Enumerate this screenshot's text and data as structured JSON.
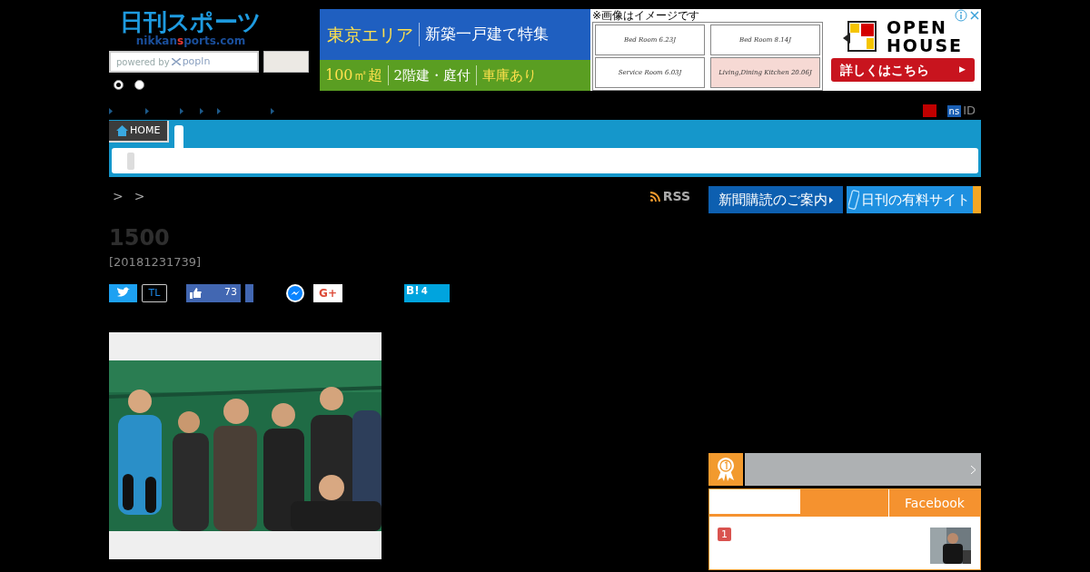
{
  "logo": {
    "title": "日刊スポーツ",
    "domain_prefix": "nikkan",
    "domain_mark": "s",
    "domain_suffix": "ports.com"
  },
  "search": {
    "placeholder_lead": "powered by",
    "placeholder_brand": "popln"
  },
  "search_scope": [
    {
      "selected": true
    },
    {
      "selected": false
    }
  ],
  "ad": {
    "headline_1": "東京エリア",
    "headline_2": "新築一戸建て特集",
    "feature_1": "100㎡超",
    "feature_2": "2階建・庭付",
    "feature_3": "車庫あり",
    "notice": "※画像はイメージです",
    "rooms": [
      "Bed Room 6.23J",
      "Bed Room 8.14J",
      "Service Room 6.03J",
      "Living,Dining Kitchen 20.06J"
    ],
    "brand_1": "OPEN",
    "brand_2": "HOUSE",
    "cta": "詳しくはこちら",
    "cta_arrow": "▶"
  },
  "account": {
    "badge": "ns",
    "label": "ID"
  },
  "nav_tabs": [
    {
      "label": "HOME",
      "selected": true
    },
    {
      "selected": false
    }
  ],
  "breadcrumb": [
    ">",
    ">"
  ],
  "rss": "RSS",
  "promo_buttons": [
    {
      "label": "新聞購読のご案内",
      "kind": "plain"
    },
    {
      "label": "日刊の有料サイト",
      "kind": "phone"
    }
  ],
  "article": {
    "title": "1500",
    "date": "[20181231739]"
  },
  "share": {
    "timeline": "TL",
    "likes": "73",
    "hatena": "B!",
    "hatena_count": "4",
    "gplus": "G+"
  },
  "ranking": {
    "tabs": [
      {
        "selected": true
      },
      {
        "selected": false
      },
      {
        "label": "Facebook",
        "selected": false
      }
    ],
    "items": [
      {
        "rank": "1"
      }
    ]
  }
}
